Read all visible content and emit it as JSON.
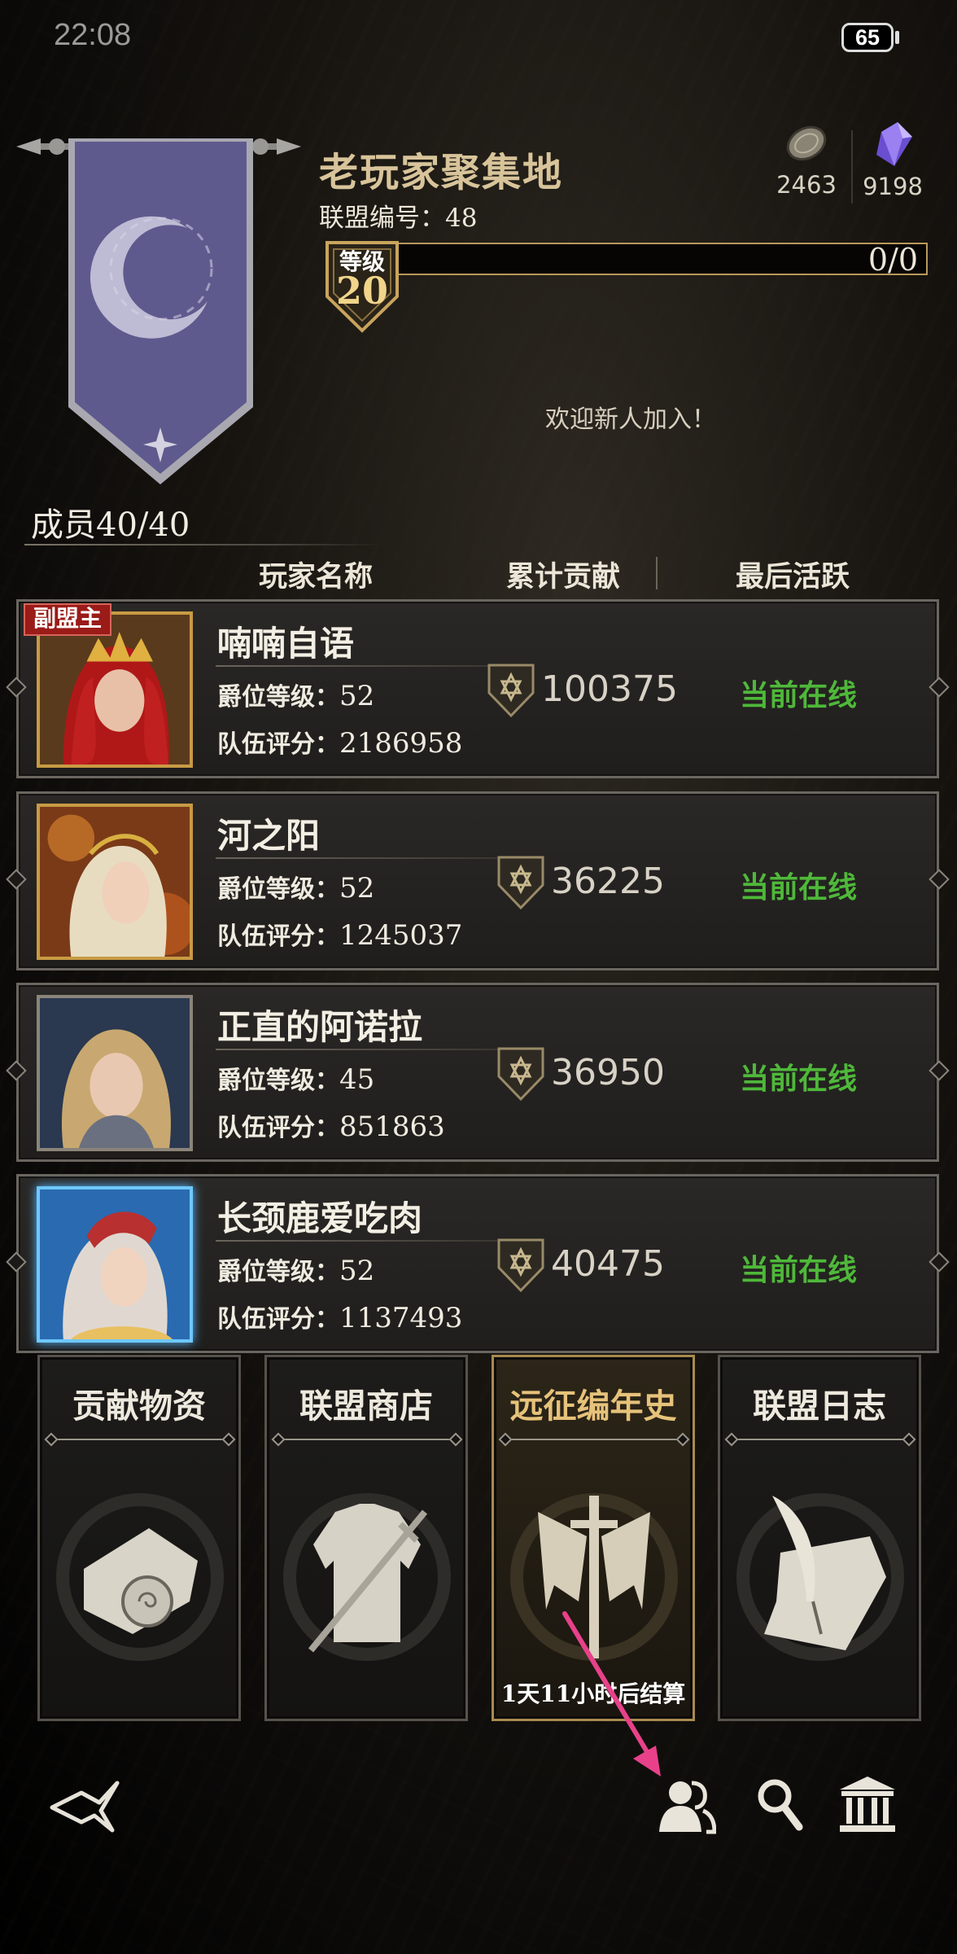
{
  "status_bar": {
    "time": "22:08",
    "battery": "65"
  },
  "alliance": {
    "name": "老玩家聚集地",
    "id_label": "联盟编号：48",
    "level_label": "等级",
    "level": "20",
    "level_progress": "0/0",
    "welcome": "欢迎新人加入！",
    "members": "成员40/40"
  },
  "resources": [
    {
      "icon": "coin-icon",
      "value": "2463"
    },
    {
      "icon": "crystal-icon",
      "value": "9198"
    }
  ],
  "columns": {
    "name": "玩家名称",
    "contribution": "累计贡献",
    "last_active": "最后活跃"
  },
  "members": [
    {
      "role": "副盟主",
      "name": "喃喃自语",
      "rank_label": "爵位等级：",
      "rank": "52",
      "score_label": "队伍评分：",
      "score": "2186958",
      "contribution": "100375",
      "status": "当前在线",
      "frame": "gold"
    },
    {
      "role": "",
      "name": "河之阳",
      "rank_label": "爵位等级：",
      "rank": "52",
      "score_label": "队伍评分：",
      "score": "1245037",
      "contribution": "36225",
      "status": "当前在线",
      "frame": "gold"
    },
    {
      "role": "",
      "name": "正直的阿诺拉",
      "rank_label": "爵位等级：",
      "rank": "45",
      "score_label": "队伍评分：",
      "score": "851863",
      "contribution": "36950",
      "status": "当前在线",
      "frame": "steel"
    },
    {
      "role": "",
      "name": "长颈鹿爱吃肉",
      "rank_label": "爵位等级：",
      "rank": "52",
      "score_label": "队伍评分：",
      "score": "1137493",
      "contribution": "40475",
      "status": "当前在线",
      "frame": "ice"
    }
  ],
  "cards": [
    {
      "title": "贡献物资",
      "icon": "scroll-icon"
    },
    {
      "title": "联盟商店",
      "icon": "armor-icon"
    },
    {
      "title": "远征编年史",
      "icon": "sword-flags-icon",
      "note": "1天11小时后结算"
    },
    {
      "title": "联盟日志",
      "icon": "quill-icon"
    }
  ],
  "nav": [
    "back-icon",
    "members-icon",
    "search-icon",
    "hall-icon"
  ],
  "colors": {
    "gold": "#d8c49a",
    "online": "#4fb83a",
    "annotation": "#e8418a",
    "banner": "#5e5a8e"
  }
}
